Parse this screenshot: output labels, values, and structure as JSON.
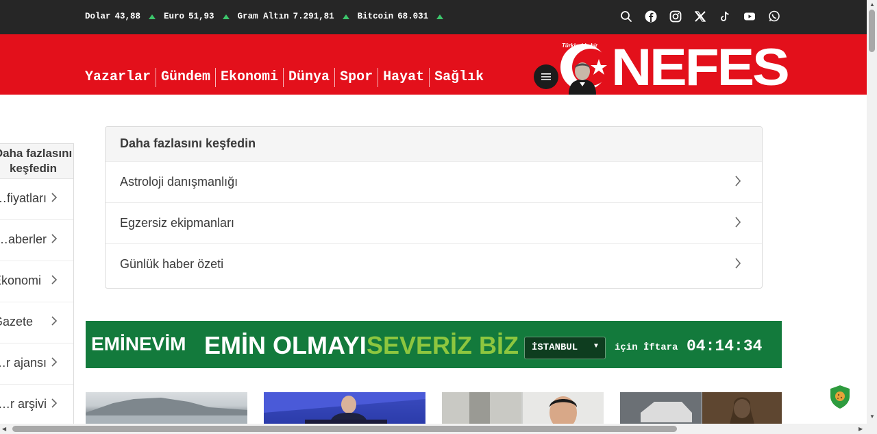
{
  "ticker": [
    {
      "name": "Dolar",
      "value": "43,88"
    },
    {
      "name": "Euro",
      "value": "51,93"
    },
    {
      "name": "Gram Altın",
      "value": "7.291,81"
    },
    {
      "name": "Bitcoin",
      "value": "68.031"
    }
  ],
  "social_icons": [
    "search-icon",
    "facebook-icon",
    "instagram-icon",
    "x-icon",
    "tiktok-icon",
    "youtube-icon",
    "whatsapp-icon"
  ],
  "nav": [
    "Yazarlar",
    "Gündem",
    "Ekonomi",
    "Dünya",
    "Spor",
    "Hayat",
    "Sağlık"
  ],
  "logo": {
    "tagline": "Türkiye'de bir",
    "text": "NEFES"
  },
  "sidebar": {
    "title": "Daha fazlasını keşfedin",
    "items": [
      "Altın fiyatları",
      "Güncel haberler",
      "Ekonomi",
      "Gazete",
      "Haber ajansı",
      "Haber arşivi"
    ]
  },
  "discover": {
    "title": "Daha fazlasını keşfedin",
    "items": [
      "Astroloji danışmanlığı",
      "Egzersiz ekipmanları",
      "Günlük haber özeti"
    ]
  },
  "banner": {
    "brand": "EMİNEVİM",
    "slogan_part1": "EMİN OLMAYI",
    "slogan_part2": "SEVERİZ BİZ",
    "city": "İSTANBUL",
    "label": "için İftara",
    "countdown": "04:14:34"
  },
  "colors": {
    "topbar": "#262626",
    "header": "#e3101b",
    "banner": "#137a3c",
    "accent_green": "#8dc63f",
    "up_arrow": "#3cc56b"
  }
}
